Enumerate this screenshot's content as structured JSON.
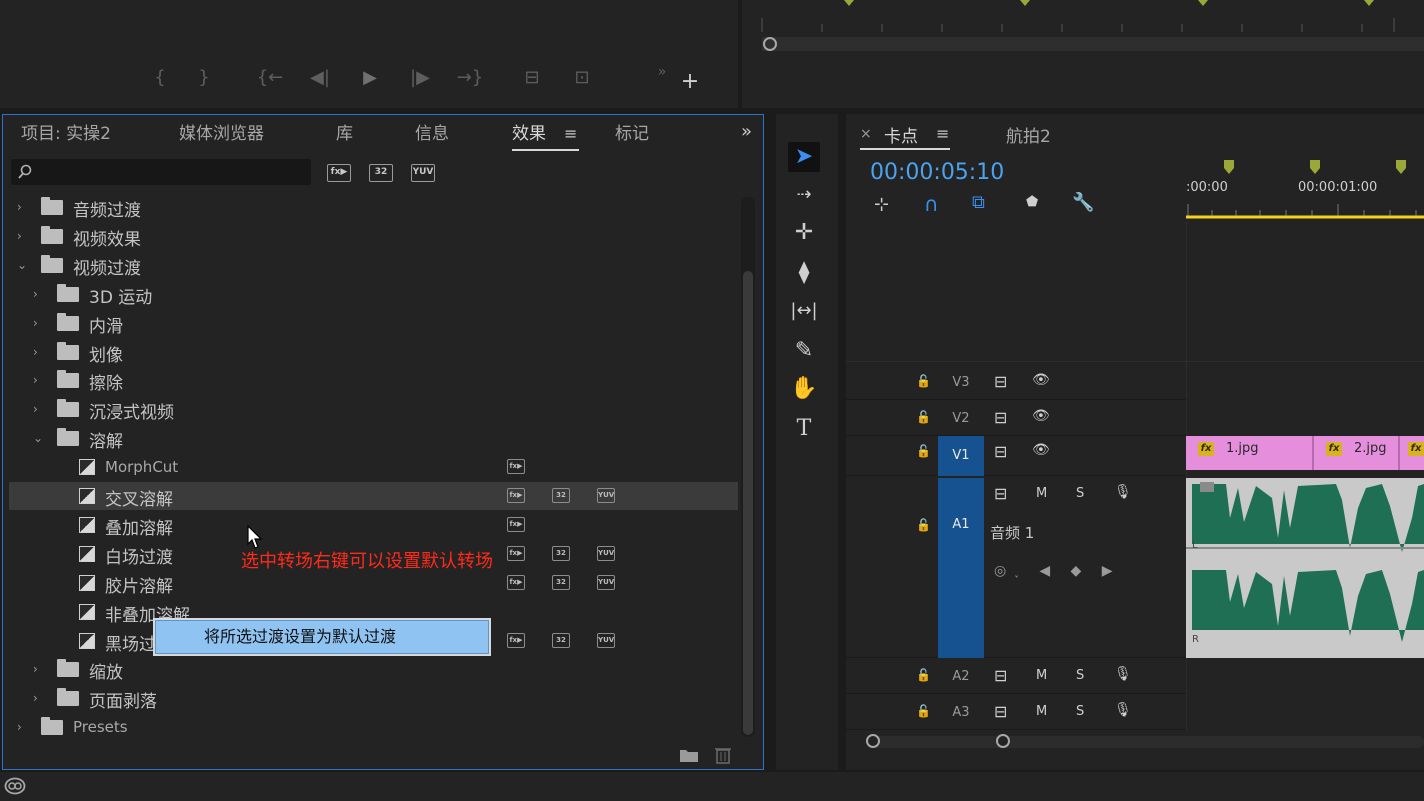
{
  "effects_panel": {
    "tabs": [
      "项目: 实操2",
      "媒体浏览器",
      "库",
      "信息",
      "效果",
      "标记"
    ],
    "active_tab": "效果",
    "toolbar_badges": [
      "32",
      "YUV"
    ],
    "tree": [
      {
        "label": "音频过渡",
        "level": 0,
        "kind": "folder",
        "expanded": false
      },
      {
        "label": "视频效果",
        "level": 0,
        "kind": "folder",
        "expanded": false
      },
      {
        "label": "视频过渡",
        "level": 0,
        "kind": "folder",
        "expanded": true
      },
      {
        "label": "3D 运动",
        "level": 1,
        "kind": "folder",
        "expanded": false
      },
      {
        "label": "内滑",
        "level": 1,
        "kind": "folder",
        "expanded": false
      },
      {
        "label": "划像",
        "level": 1,
        "kind": "folder",
        "expanded": false
      },
      {
        "label": "擦除",
        "level": 1,
        "kind": "folder",
        "expanded": false
      },
      {
        "label": "沉浸式视频",
        "level": 1,
        "kind": "folder",
        "expanded": false
      },
      {
        "label": "溶解",
        "level": 1,
        "kind": "folder",
        "expanded": true
      },
      {
        "label": "MorphCut",
        "level": 2,
        "kind": "effect",
        "badges": [
          "fx"
        ]
      },
      {
        "label": "交叉溶解",
        "level": 2,
        "kind": "effect",
        "badges": [
          "fx",
          "32",
          "YUV"
        ],
        "selected": true
      },
      {
        "label": "叠加溶解",
        "level": 2,
        "kind": "effect",
        "badges": [
          "fx"
        ]
      },
      {
        "label": "白场过渡",
        "level": 2,
        "kind": "effect",
        "badges": [
          "fx",
          "32",
          "YUV"
        ]
      },
      {
        "label": "胶片溶解",
        "level": 2,
        "kind": "effect",
        "badges": [
          "fx",
          "32",
          "YUV"
        ]
      },
      {
        "label": "非叠加溶解",
        "level": 2,
        "kind": "effect",
        "badges": []
      },
      {
        "label": "黑场过渡",
        "level": 2,
        "kind": "effect",
        "badges": [
          "fx",
          "32",
          "YUV"
        ]
      },
      {
        "label": "缩放",
        "level": 1,
        "kind": "folder",
        "expanded": false
      },
      {
        "label": "页面剥落",
        "level": 1,
        "kind": "folder",
        "expanded": false
      },
      {
        "label": "Presets",
        "level": 0,
        "kind": "preset",
        "expanded": false
      }
    ],
    "annotation": "选中转场右键可以设置默认转场",
    "context_menu_item": "将所选过渡设置为默认过渡"
  },
  "timeline": {
    "tabs": [
      "卡点",
      "航拍2"
    ],
    "active_tab": "卡点",
    "close_glyph": "×",
    "timecode": "00:00:05:10",
    "ruler_labels": [
      ":00:00",
      "00:00:01:00"
    ],
    "tracks": [
      {
        "name": "V3",
        "type": "video"
      },
      {
        "name": "V2",
        "type": "video"
      },
      {
        "name": "V1",
        "type": "video",
        "active": true
      },
      {
        "name": "A1",
        "type": "audio",
        "active": true,
        "label": "音频 1"
      },
      {
        "name": "A2",
        "type": "audio"
      },
      {
        "name": "A3",
        "type": "audio"
      }
    ],
    "clips": [
      {
        "name": "1.jpg"
      },
      {
        "name": "2.jpg"
      }
    ],
    "audio_track_buttons": [
      "M",
      "S"
    ],
    "waveform_channel_labels": [
      "L",
      "R"
    ],
    "colors": {
      "clip": "#e58fdc",
      "waveform": "#1f6f55",
      "track_active": "#16528f",
      "timecode": "#4aa3f0",
      "work_area": "#f2d21c"
    }
  }
}
